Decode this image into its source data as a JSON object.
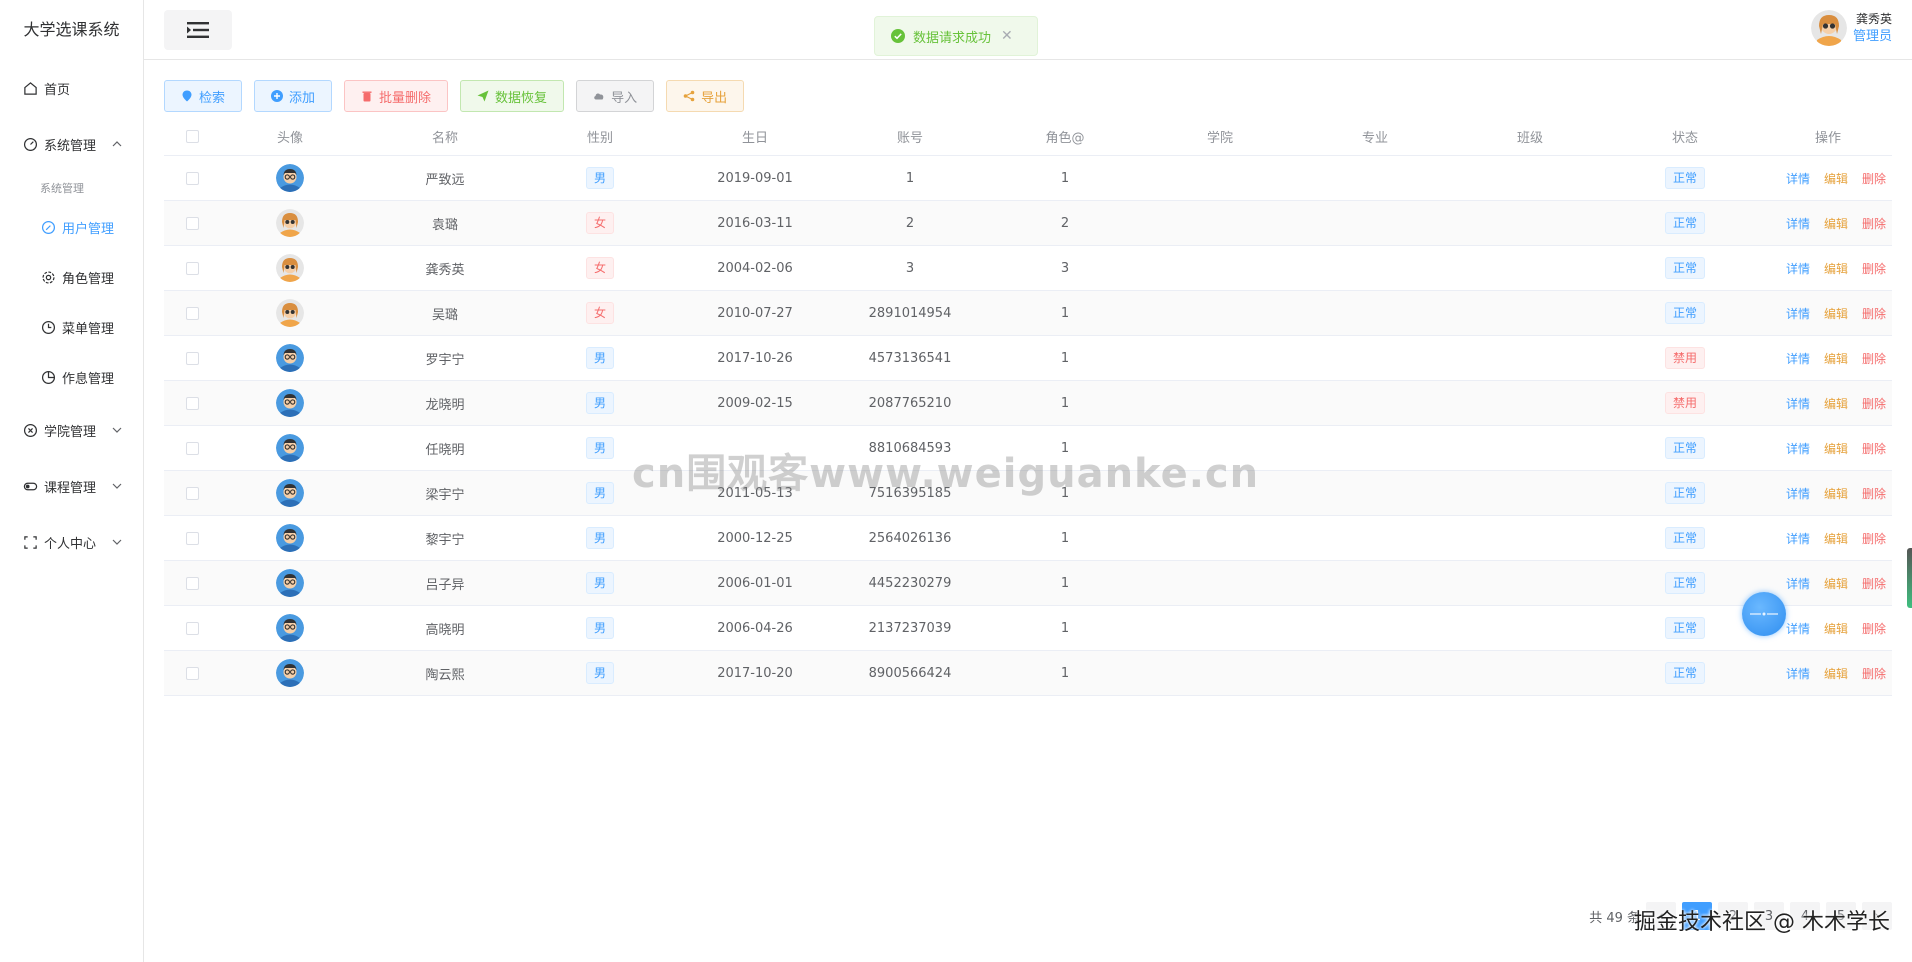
{
  "app_title": "大学选课系统",
  "sidebar": {
    "home": "首页",
    "system_mgmt": "系统管理",
    "group_title": "系统管理",
    "user_mgmt": "用户管理",
    "role_mgmt": "角色管理",
    "menu_mgmt": "菜单管理",
    "schedule_mgmt": "作息管理",
    "college_mgmt": "学院管理",
    "course_mgmt": "课程管理",
    "personal_center": "个人中心"
  },
  "header": {
    "user_name": "龚秀英",
    "user_role": "管理员"
  },
  "toast": {
    "text": "数据请求成功",
    "type": "success"
  },
  "toolbar": {
    "search": "检索",
    "add": "添加",
    "batch_delete": "批量删除",
    "restore": "数据恢复",
    "import": "导入",
    "export": "导出"
  },
  "table": {
    "headers": {
      "avatar": "头像",
      "name": "名称",
      "gender": "性别",
      "birthday": "生日",
      "account": "账号",
      "role": "角色@",
      "college": "学院",
      "major": "专业",
      "class": "班级",
      "status": "状态",
      "actions": "操作"
    },
    "action_labels": {
      "detail": "详情",
      "edit": "编辑",
      "delete": "删除"
    },
    "rows": [
      {
        "name": "严致远",
        "gender": "男",
        "birthday": "2019-09-01",
        "account": "1",
        "role": "1",
        "status": "正常",
        "avatar": "male"
      },
      {
        "name": "袁璐",
        "gender": "女",
        "birthday": "2016-03-11",
        "account": "2",
        "role": "2",
        "status": "正常",
        "avatar": "female"
      },
      {
        "name": "龚秀英",
        "gender": "女",
        "birthday": "2004-02-06",
        "account": "3",
        "role": "3",
        "status": "正常",
        "avatar": "female"
      },
      {
        "name": "吴璐",
        "gender": "女",
        "birthday": "2010-07-27",
        "account": "2891014954",
        "role": "1",
        "status": "正常",
        "avatar": "female"
      },
      {
        "name": "罗宇宁",
        "gender": "男",
        "birthday": "2017-10-26",
        "account": "4573136541",
        "role": "1",
        "status": "禁用",
        "avatar": "male"
      },
      {
        "name": "龙晓明",
        "gender": "男",
        "birthday": "2009-02-15",
        "account": "2087765210",
        "role": "1",
        "status": "禁用",
        "avatar": "male"
      },
      {
        "name": "任晓明",
        "gender": "男",
        "birthday": "",
        "account": "8810684593",
        "role": "1",
        "status": "正常",
        "avatar": "male"
      },
      {
        "name": "梁宇宁",
        "gender": "男",
        "birthday": "2011-05-13",
        "account": "7516395185",
        "role": "1",
        "status": "正常",
        "avatar": "male"
      },
      {
        "name": "黎宇宁",
        "gender": "男",
        "birthday": "2000-12-25",
        "account": "2564026136",
        "role": "1",
        "status": "正常",
        "avatar": "male"
      },
      {
        "name": "吕子异",
        "gender": "男",
        "birthday": "2006-01-01",
        "account": "4452230279",
        "role": "1",
        "status": "正常",
        "avatar": "male"
      },
      {
        "name": "高晓明",
        "gender": "男",
        "birthday": "2006-04-26",
        "account": "2137237039",
        "role": "1",
        "status": "正常",
        "avatar": "male"
      },
      {
        "name": "陶云熙",
        "gender": "男",
        "birthday": "2017-10-20",
        "account": "8900566424",
        "role": "1",
        "status": "正常",
        "avatar": "male"
      }
    ]
  },
  "pagination": {
    "total_text": "共 49 条",
    "pages": [
      "1",
      "2",
      "3",
      "4",
      "5"
    ],
    "current": "1"
  },
  "watermarks": {
    "center": "cn围观客www.weiguanke.cn",
    "corner": "掘金技术社区 @ 木木学长"
  }
}
